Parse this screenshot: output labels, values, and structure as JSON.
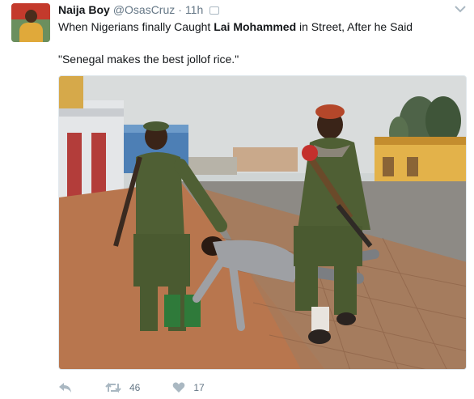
{
  "tweet": {
    "display_name": "Naija Boy",
    "handle": "@OsasCruz",
    "separator": "·",
    "time": "11h",
    "text_before": "When Nigerians finally Caught ",
    "text_bold": "Lai Mohammed",
    "text_after": " in Street, After he Said",
    "quote_line": "\"Senegal makes the best jollof rice.\"",
    "photo_description_icon": "photo"
  },
  "actions": {
    "reply_icon": "reply-icon",
    "retweet_icon": "retweet-icon",
    "retweet_count": "46",
    "like_icon": "heart-icon",
    "like_count": "17"
  },
  "colors": {
    "text": "#14171a",
    "muted": "#657786",
    "icon": "#aab8c2"
  }
}
